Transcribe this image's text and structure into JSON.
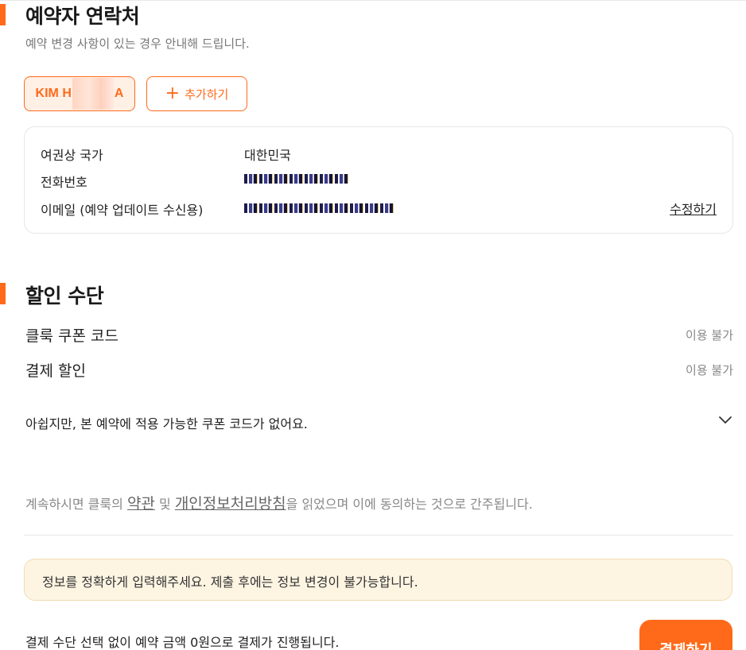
{
  "contact": {
    "title": "예약자 연락처",
    "subtitle": "예약 변경 사항이 있는 경우 안내해 드립니다.",
    "traveler_chip": {
      "prefix": "KIM H",
      "suffix": "A"
    },
    "add_button": {
      "icon": "plus-icon",
      "label": "추가하기"
    },
    "rows": [
      {
        "label": "여권상 국가",
        "value": "대한민국"
      },
      {
        "label": "전화번호",
        "value": ""
      },
      {
        "label": "이메일 (예약 업데이트 수신용)",
        "value": ""
      }
    ],
    "edit_label": "수정하기"
  },
  "discount": {
    "title": "할인 수단",
    "items": [
      {
        "label": "클룩 쿠폰 코드",
        "status": "이용 불가"
      },
      {
        "label": "결제 할인",
        "status": "이용 불가"
      }
    ],
    "coupon_message": "아쉽지만, 본 예약에 적용 가능한 쿠폰 코드가 없어요.",
    "coupon_icon": "chevron-down-icon"
  },
  "terms": {
    "prefix": "계속하시면 클룩의 ",
    "link1": "약관",
    "middle": " 및 ",
    "link2": "개인정보처리방침",
    "suffix": "을 읽었으며 이에 동의하는 것으로 간주됩니다."
  },
  "notice": "정보를 정확하게 입력해주세요. 제출 후에는 정보 변경이 불가능합니다.",
  "payment": {
    "note": "결제 수단 선택 없이 예약 금액 0원으로 결제가 진행됩니다.",
    "button_label": "결제하기"
  },
  "colors": {
    "accent": "#ff6a1a",
    "notice_bg": "#fdf4e2",
    "muted": "#888888"
  }
}
